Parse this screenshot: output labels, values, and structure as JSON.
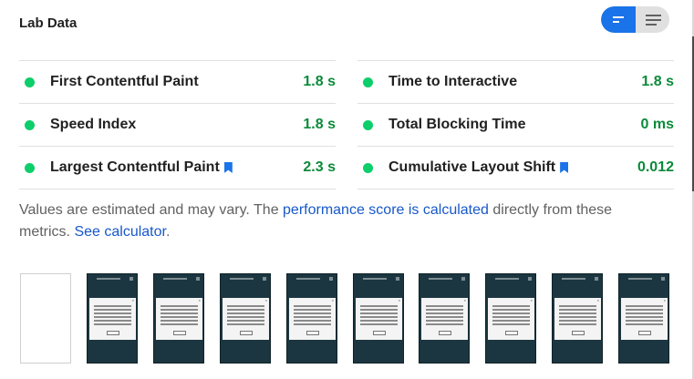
{
  "section": {
    "title": "Lab Data"
  },
  "view_toggle": {
    "compact_icon": "compact-view-icon",
    "expanded_icon": "expanded-view-icon",
    "active": "compact",
    "accent": "#1a73e8"
  },
  "metrics": {
    "left": [
      {
        "label": "First Contentful Paint",
        "value": "1.8 s",
        "status": "pass"
      },
      {
        "label": "Speed Index",
        "value": "1.8 s",
        "status": "pass"
      },
      {
        "label": "Largest Contentful Paint",
        "value": "2.3 s",
        "status": "pass",
        "bookmark": true
      }
    ],
    "right": [
      {
        "label": "Time to Interactive",
        "value": "1.8 s",
        "status": "pass"
      },
      {
        "label": "Total Blocking Time",
        "value": "0 ms",
        "status": "pass"
      },
      {
        "label": "Cumulative Layout Shift",
        "value": "0.012",
        "status": "pass",
        "bookmark": true
      }
    ],
    "colors": {
      "pass_dot": "#0cce6b",
      "pass_value": "#0b8a3a"
    }
  },
  "note": {
    "prefix": "Values are estimated and may vary. The ",
    "link1": "performance score is calculated",
    "middle": " directly from these metrics. ",
    "link2": "See calculator",
    "suffix": "."
  },
  "filmstrip": {
    "frames": [
      "blank",
      "screenshot",
      "screenshot",
      "screenshot",
      "screenshot",
      "screenshot",
      "screenshot",
      "screenshot",
      "screenshot",
      "screenshot"
    ]
  }
}
